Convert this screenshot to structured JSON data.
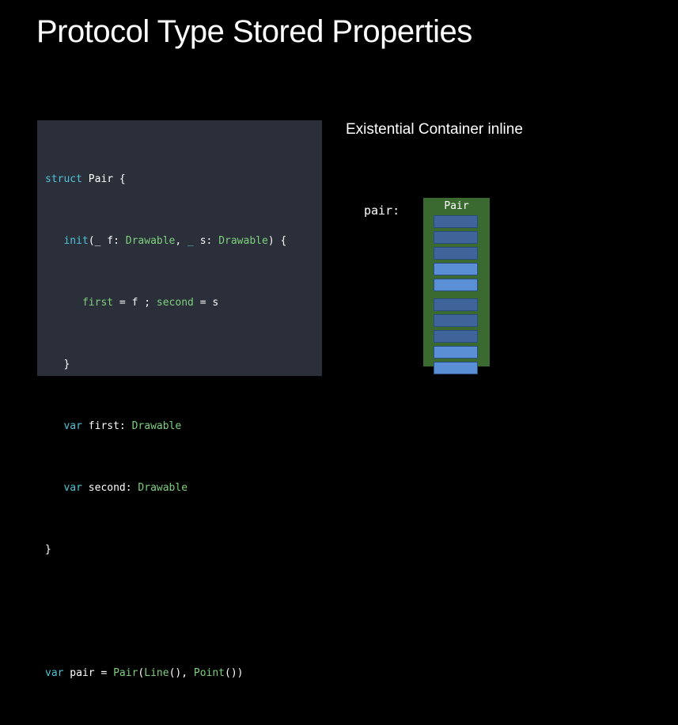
{
  "slide": {
    "title": "Protocol Type Stored Properties",
    "subtitle": "Existential Container inline",
    "var_label": "pair:",
    "container_label": "Pair"
  },
  "code": {
    "l1": {
      "a": "struct",
      "b": " Pair {"
    },
    "l2": {
      "a": "   ",
      "b": "init",
      "c": "(_ ",
      "d": "f",
      "e": ": ",
      "f": "Drawable",
      "g": ", ",
      "h": "_",
      "i": " s: ",
      "j": "Drawable",
      "k": ") {"
    },
    "l3": {
      "a": "      ",
      "b": "first",
      "c": " = f ; ",
      "d": "second",
      "e": " = s"
    },
    "l4": {
      "a": "   }"
    },
    "l5": {
      "a": "   ",
      "b": "var",
      "c": " first: ",
      "d": "Drawable"
    },
    "l6": {
      "a": "   ",
      "b": "var",
      "c": " second: ",
      "d": "Drawable"
    },
    "l7": {
      "a": "}"
    },
    "l9": {
      "a": "var",
      "b": " pair = ",
      "c": "Pair",
      "d": "(",
      "e": "Line",
      "f": "(), ",
      "g": "Point",
      "h": "())"
    }
  },
  "colors": {
    "background": "#000000",
    "code_panel": "#2b2f3a",
    "keyword": "#4fc3d6",
    "type": "#7ed07e",
    "container": "#3b6a31",
    "cell_dark": "#3e6499",
    "cell_light": "#5a8fd6"
  }
}
